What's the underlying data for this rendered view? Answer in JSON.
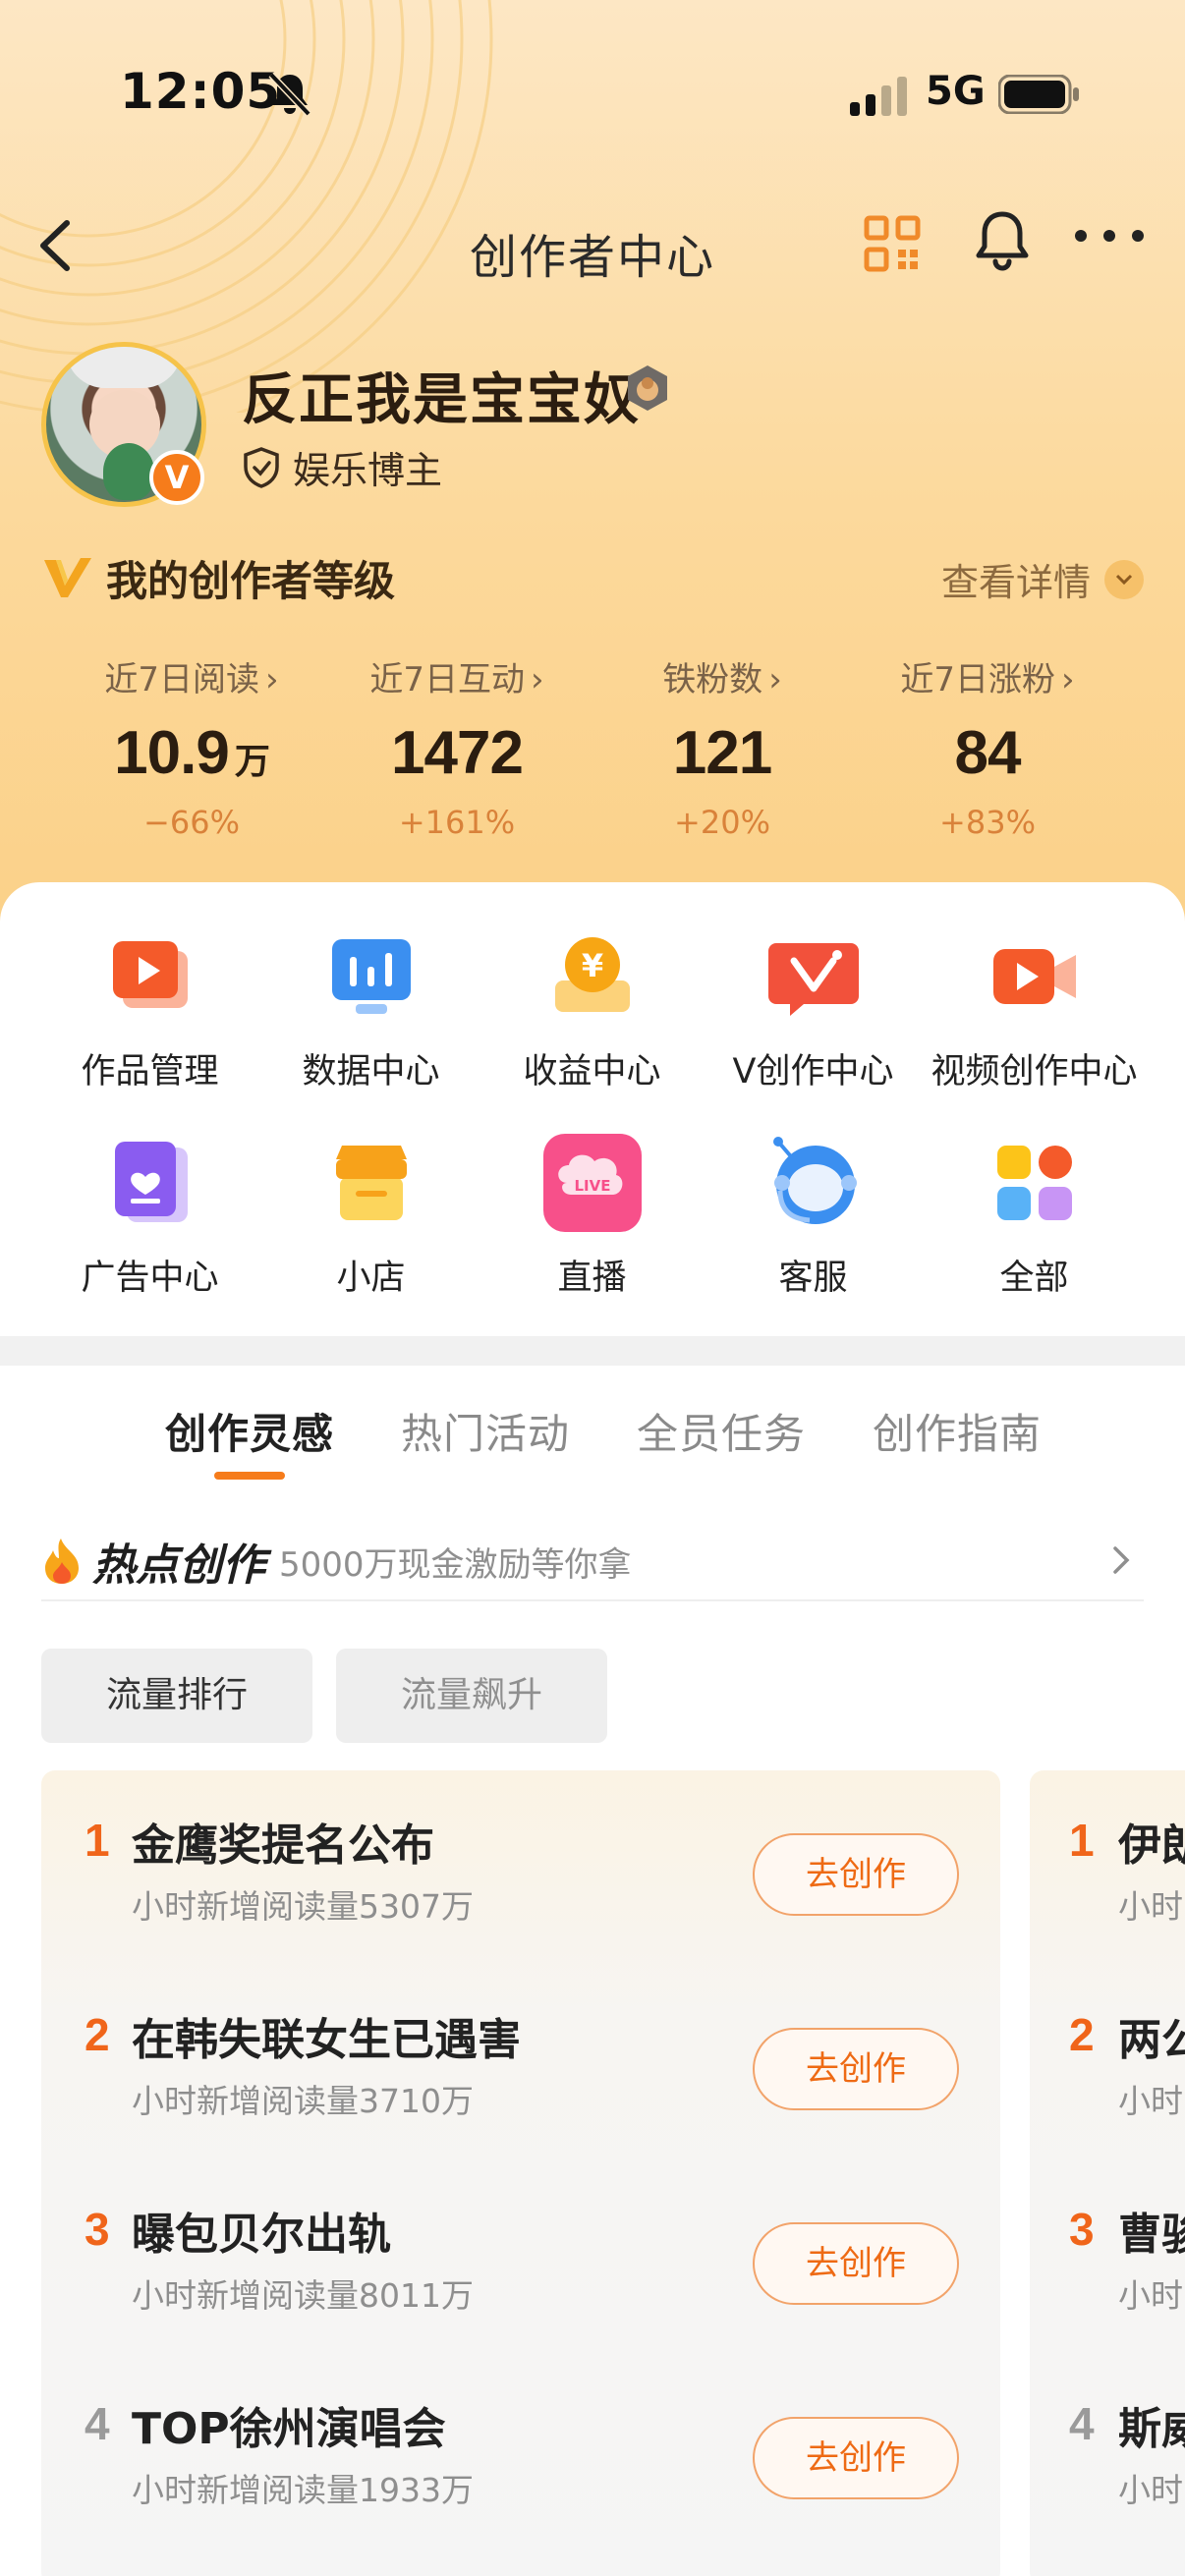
{
  "status_bar": {
    "time": "12:05",
    "network": "5G"
  },
  "nav": {
    "title": "创作者中心"
  },
  "profile": {
    "name": "反正我是宝宝奴",
    "role": "娱乐博主",
    "verified_mark": "V"
  },
  "level": {
    "title": "我的创作者等级",
    "detail_link": "查看详情"
  },
  "stats": [
    {
      "label": "近7日阅读",
      "value": "10.9",
      "unit": "万",
      "change": "−66%"
    },
    {
      "label": "近7日互动",
      "value": "1472",
      "unit": "",
      "change": "+161%"
    },
    {
      "label": "铁粉数",
      "value": "121",
      "unit": "",
      "change": "+20%"
    },
    {
      "label": "近7日涨粉",
      "value": "84",
      "unit": "",
      "change": "+83%"
    }
  ],
  "tools": [
    {
      "label": "作品管理",
      "icon": "works-manage-icon"
    },
    {
      "label": "数据中心",
      "icon": "data-center-icon"
    },
    {
      "label": "收益中心",
      "icon": "income-center-icon"
    },
    {
      "label": "V创作中心",
      "icon": "v-create-icon"
    },
    {
      "label": "视频创作中心",
      "icon": "video-create-icon"
    },
    {
      "label": "广告中心",
      "icon": "ad-center-icon"
    },
    {
      "label": "小店",
      "icon": "shop-icon"
    },
    {
      "label": "直播",
      "icon": "live-icon"
    },
    {
      "label": "客服",
      "icon": "customer-service-icon"
    },
    {
      "label": "全部",
      "icon": "all-apps-icon"
    }
  ],
  "tabs": [
    {
      "label": "创作灵感",
      "active": true
    },
    {
      "label": "热门活动",
      "active": false
    },
    {
      "label": "全员任务",
      "active": false
    },
    {
      "label": "创作指南",
      "active": false
    }
  ],
  "hot": {
    "title": "热点创作",
    "subtitle": "5000万现金激励等你拿"
  },
  "filters": [
    {
      "label": "流量排行",
      "active": true
    },
    {
      "label": "流量飙升",
      "active": false
    }
  ],
  "rank_list": [
    {
      "rank": "1",
      "title": "金鹰奖提名公布",
      "meta": "小时新增阅读量5307万",
      "action": "去创作"
    },
    {
      "rank": "2",
      "title": "在韩失联女生已遇害",
      "meta": "小时新增阅读量3710万",
      "action": "去创作"
    },
    {
      "rank": "3",
      "title": "曝包贝尔出轨",
      "meta": "小时新增阅读量8011万",
      "action": "去创作"
    },
    {
      "rank": "4",
      "title": "TOP徐州演唱会",
      "meta": "小时新增阅读量1933万",
      "action": "去创作"
    }
  ],
  "rank_list_2": [
    {
      "rank": "1",
      "title": "伊朗",
      "meta": "小时"
    },
    {
      "rank": "2",
      "title": "两公",
      "meta": "小时"
    },
    {
      "rank": "3",
      "title": "曹骏",
      "meta": "小时"
    },
    {
      "rank": "4",
      "title": "斯威",
      "meta": "小时"
    }
  ],
  "colors": {
    "accent": "#f67c1b",
    "hero_top": "#fde7c4",
    "hero_bottom": "#fbd189"
  }
}
